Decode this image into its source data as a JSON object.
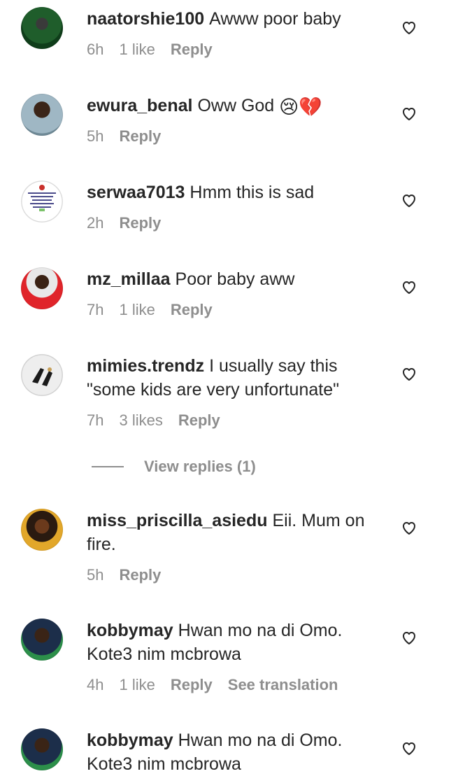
{
  "comments": [
    {
      "username": "naatorshie100",
      "text": "Awww poor baby",
      "time": "6h",
      "likes": "1 like",
      "reply": "Reply"
    },
    {
      "username": "ewura_benal",
      "text": "Oww God",
      "emoji": "😢💔",
      "time": "5h",
      "reply": "Reply"
    },
    {
      "username": "serwaa7013",
      "text": "Hmm this is sad",
      "time": "2h",
      "reply": "Reply"
    },
    {
      "username": "mz_millaa",
      "text": "Poor baby aww",
      "time": "7h",
      "likes": "1 like",
      "reply": "Reply"
    },
    {
      "username": "mimies.trendz",
      "text": "I usually say this \"some kids are very unfortunate\"",
      "time": "7h",
      "likes": "3 likes",
      "reply": "Reply"
    },
    {
      "username": "miss_priscilla_asiedu",
      "text": "Eii. Mum on fire.",
      "time": "5h",
      "reply": "Reply"
    },
    {
      "username": "kobbymay",
      "text": "Hwan mo na di Omo. Kote3 nim mcbrowa",
      "time": "4h",
      "likes": "1 like",
      "reply": "Reply",
      "translate": "See translation"
    },
    {
      "username": "kobbymay",
      "text": "Hwan mo na di Omo. Kote3 nim mcbrowa"
    }
  ],
  "view_replies": "View replies (1)",
  "icons": {
    "like": "heart-outline-icon"
  },
  "colors": {
    "text": "#262626",
    "meta": "#8e8e8e"
  }
}
